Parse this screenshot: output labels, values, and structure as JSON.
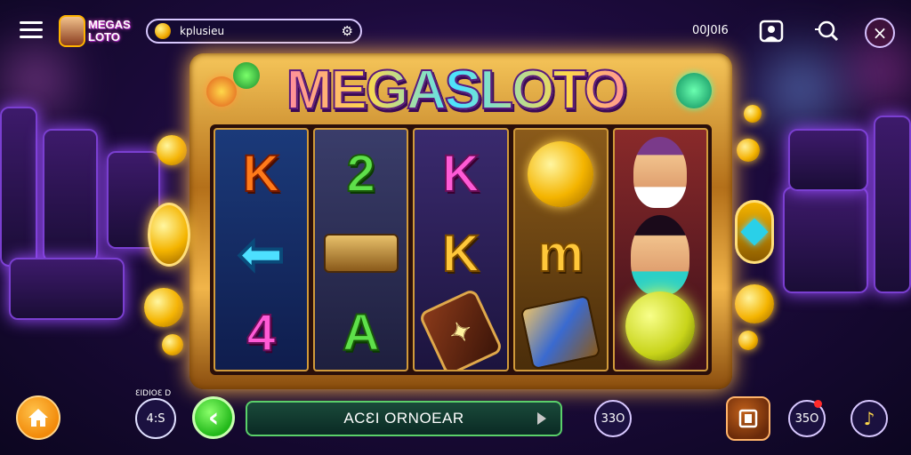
{
  "header": {
    "brand_line1": "MEGAS",
    "brand_line2": "LOTO",
    "search_text": "kplusieu",
    "counter": "00J0I6",
    "icons": [
      "menu-icon",
      "coin-icon",
      "settings-icon",
      "profile-icon",
      "search-icon",
      "close-icon"
    ]
  },
  "machine": {
    "title": "MEGASLOTO",
    "reels": [
      [
        "K",
        "arrow",
        "4"
      ],
      [
        "2",
        "gold-bars",
        "A"
      ],
      [
        "K",
        "K",
        "scroll"
      ],
      [
        "coin",
        "m",
        "cube"
      ],
      [
        "girl",
        "girl",
        "orb"
      ]
    ]
  },
  "footer": {
    "bet_label": "ƐIDIOƐ D",
    "bet_value": "4:S",
    "action_label": "ACƐI ORNOEAR",
    "round_1": "33O",
    "round_2": "35O"
  },
  "colors": {
    "accent_gold": "#f4b400",
    "accent_pink": "#ff5ad6",
    "spin_green": "#22b81a",
    "home_orange": "#f28a0a"
  }
}
